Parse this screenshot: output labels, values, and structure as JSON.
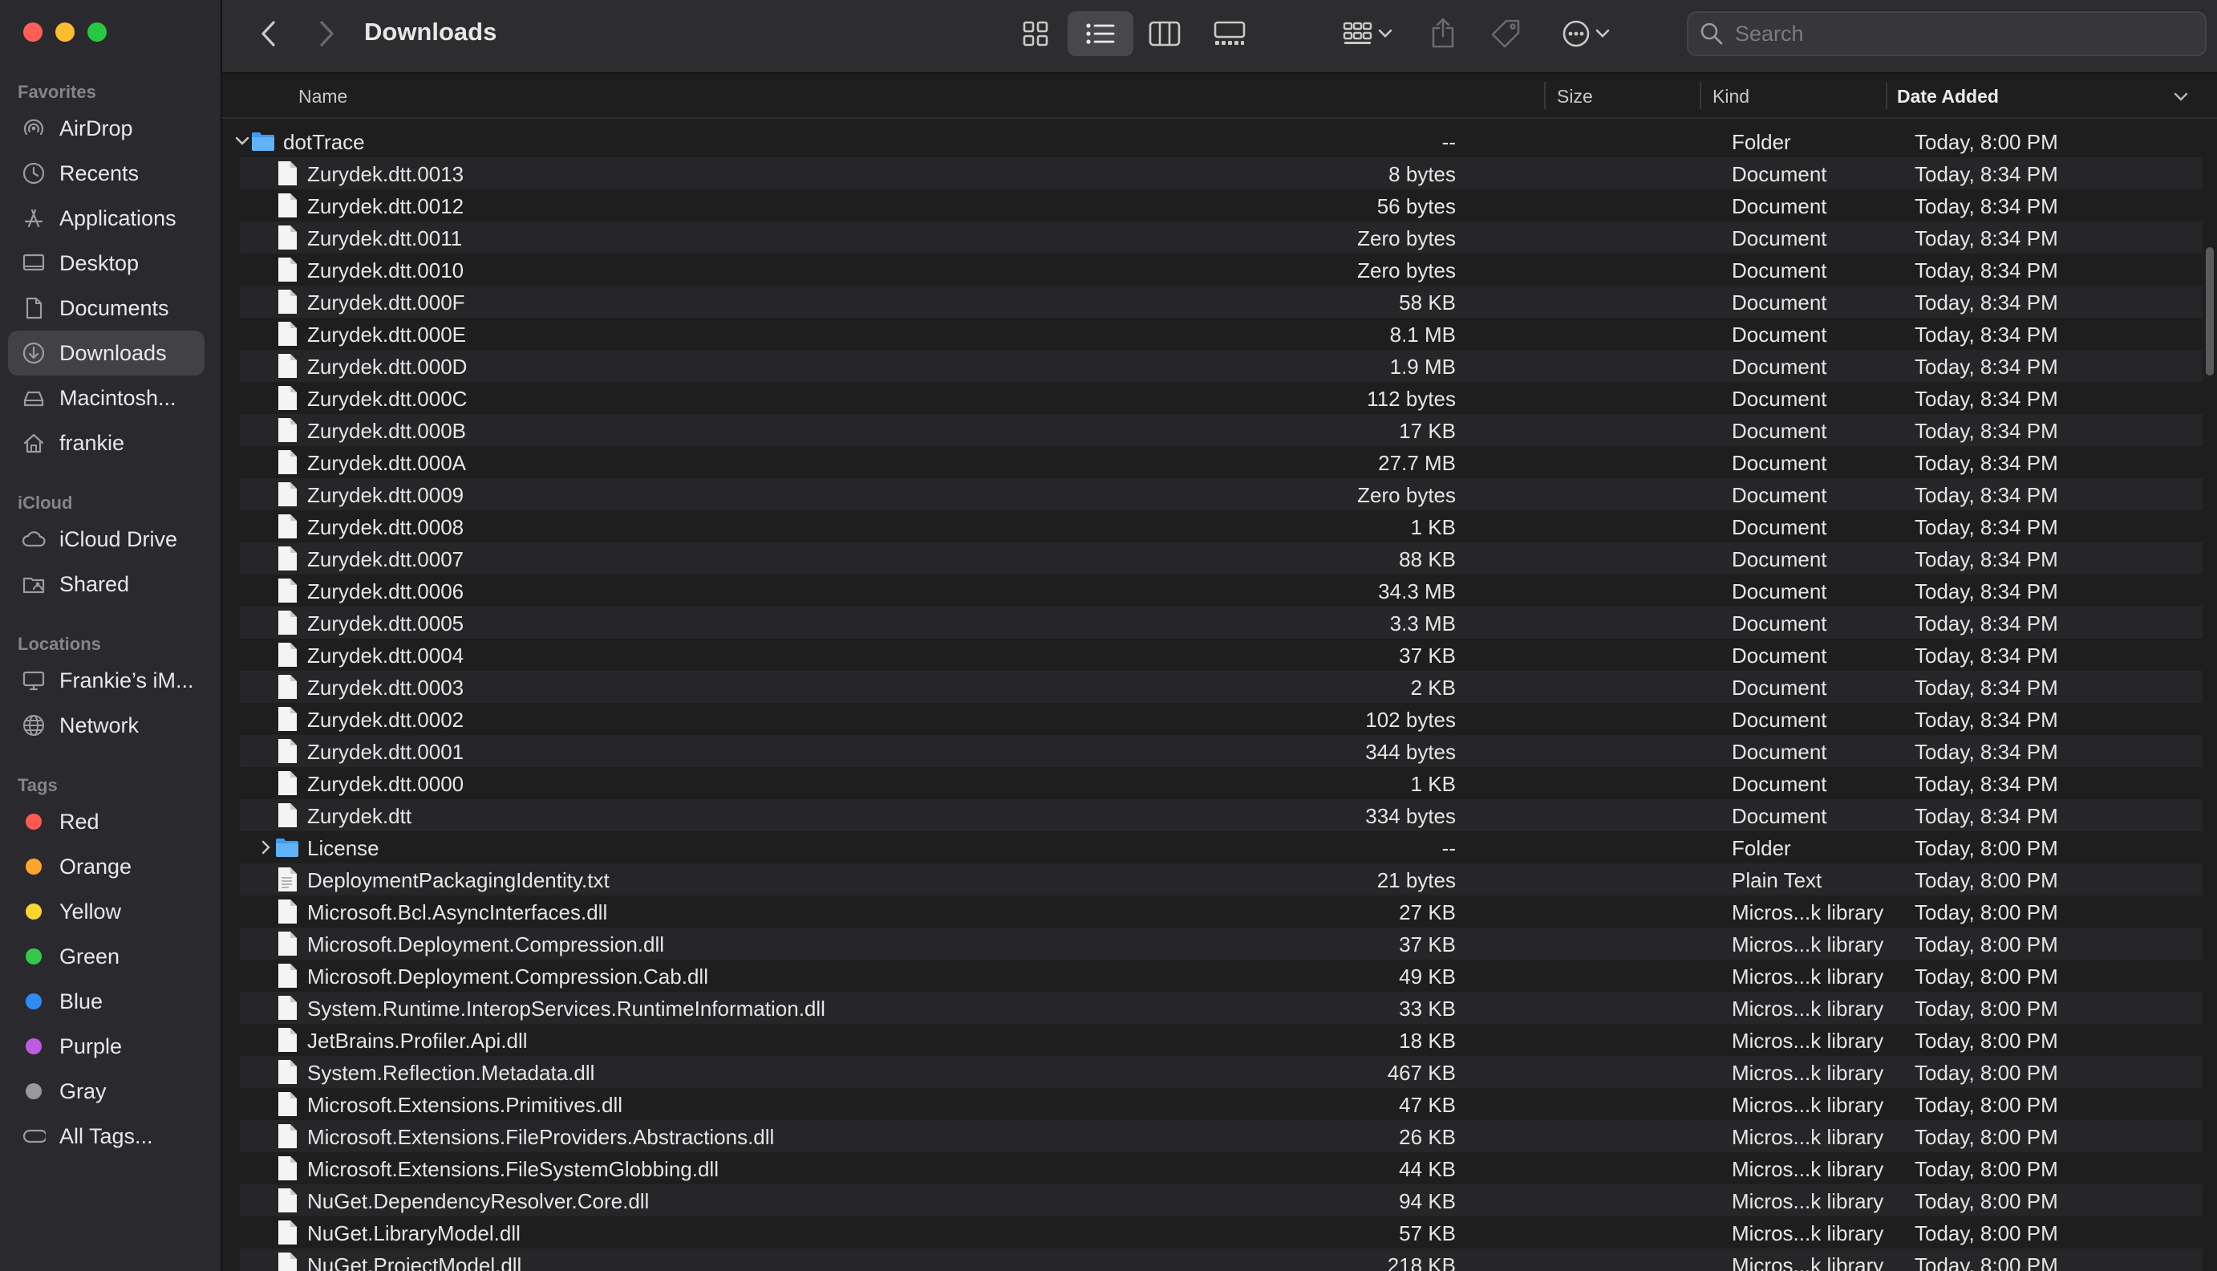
{
  "window": {
    "title": "Downloads"
  },
  "sidebar": {
    "sections": {
      "favorites": "Favorites",
      "icloud": "iCloud",
      "locations": "Locations",
      "tags": "Tags"
    },
    "favorites": [
      {
        "label": "AirDrop",
        "icon": "airdrop-icon"
      },
      {
        "label": "Recents",
        "icon": "clock-icon"
      },
      {
        "label": "Applications",
        "icon": "applications-icon"
      },
      {
        "label": "Desktop",
        "icon": "desktop-icon"
      },
      {
        "label": "Documents",
        "icon": "document-icon"
      },
      {
        "label": "Downloads",
        "icon": "download-icon",
        "active": true
      },
      {
        "label": "Macintosh...",
        "icon": "drive-icon"
      },
      {
        "label": "frankie",
        "icon": "home-icon"
      }
    ],
    "icloud": [
      {
        "label": "iCloud Drive",
        "icon": "cloud-icon"
      },
      {
        "label": "Shared",
        "icon": "shared-folder-icon"
      }
    ],
    "locations": [
      {
        "label": "Frankie’s iM...",
        "icon": "computer-icon"
      },
      {
        "label": "Network",
        "icon": "globe-icon"
      }
    ],
    "tags": [
      {
        "label": "Red",
        "color": "#ff5a52"
      },
      {
        "label": "Orange",
        "color": "#fea52b"
      },
      {
        "label": "Yellow",
        "color": "#fdd52f"
      },
      {
        "label": "Green",
        "color": "#36c84a"
      },
      {
        "label": "Blue",
        "color": "#2f8cf6"
      },
      {
        "label": "Purple",
        "color": "#bd5ce0"
      },
      {
        "label": "Gray",
        "color": "#98989d"
      },
      {
        "label": "All Tags...",
        "icon": "all-tags-icon"
      }
    ]
  },
  "search": {
    "placeholder": "Search"
  },
  "columns": {
    "name": "Name",
    "size": "Size",
    "kind": "Kind",
    "date": "Date Added"
  },
  "files": [
    {
      "name": "dotTrace",
      "size": "--",
      "kind": "Folder",
      "date": "Today, 8:00 PM",
      "type": "folder",
      "level": 0,
      "expanded": true
    },
    {
      "name": "Zurydek.dtt.0013",
      "size": "8 bytes",
      "kind": "Document",
      "date": "Today, 8:34 PM",
      "type": "doc",
      "level": 1
    },
    {
      "name": "Zurydek.dtt.0012",
      "size": "56 bytes",
      "kind": "Document",
      "date": "Today, 8:34 PM",
      "type": "doc",
      "level": 1
    },
    {
      "name": "Zurydek.dtt.0011",
      "size": "Zero bytes",
      "kind": "Document",
      "date": "Today, 8:34 PM",
      "type": "doc",
      "level": 1
    },
    {
      "name": "Zurydek.dtt.0010",
      "size": "Zero bytes",
      "kind": "Document",
      "date": "Today, 8:34 PM",
      "type": "doc",
      "level": 1
    },
    {
      "name": "Zurydek.dtt.000F",
      "size": "58 KB",
      "kind": "Document",
      "date": "Today, 8:34 PM",
      "type": "doc",
      "level": 1
    },
    {
      "name": "Zurydek.dtt.000E",
      "size": "8.1 MB",
      "kind": "Document",
      "date": "Today, 8:34 PM",
      "type": "doc",
      "level": 1
    },
    {
      "name": "Zurydek.dtt.000D",
      "size": "1.9 MB",
      "kind": "Document",
      "date": "Today, 8:34 PM",
      "type": "doc",
      "level": 1
    },
    {
      "name": "Zurydek.dtt.000C",
      "size": "112 bytes",
      "kind": "Document",
      "date": "Today, 8:34 PM",
      "type": "doc",
      "level": 1
    },
    {
      "name": "Zurydek.dtt.000B",
      "size": "17 KB",
      "kind": "Document",
      "date": "Today, 8:34 PM",
      "type": "doc",
      "level": 1
    },
    {
      "name": "Zurydek.dtt.000A",
      "size": "27.7 MB",
      "kind": "Document",
      "date": "Today, 8:34 PM",
      "type": "doc",
      "level": 1
    },
    {
      "name": "Zurydek.dtt.0009",
      "size": "Zero bytes",
      "kind": "Document",
      "date": "Today, 8:34 PM",
      "type": "doc",
      "level": 1
    },
    {
      "name": "Zurydek.dtt.0008",
      "size": "1 KB",
      "kind": "Document",
      "date": "Today, 8:34 PM",
      "type": "doc",
      "level": 1
    },
    {
      "name": "Zurydek.dtt.0007",
      "size": "88 KB",
      "kind": "Document",
      "date": "Today, 8:34 PM",
      "type": "doc",
      "level": 1
    },
    {
      "name": "Zurydek.dtt.0006",
      "size": "34.3 MB",
      "kind": "Document",
      "date": "Today, 8:34 PM",
      "type": "doc",
      "level": 1
    },
    {
      "name": "Zurydek.dtt.0005",
      "size": "3.3 MB",
      "kind": "Document",
      "date": "Today, 8:34 PM",
      "type": "doc",
      "level": 1
    },
    {
      "name": "Zurydek.dtt.0004",
      "size": "37 KB",
      "kind": "Document",
      "date": "Today, 8:34 PM",
      "type": "doc",
      "level": 1
    },
    {
      "name": "Zurydek.dtt.0003",
      "size": "2 KB",
      "kind": "Document",
      "date": "Today, 8:34 PM",
      "type": "doc",
      "level": 1
    },
    {
      "name": "Zurydek.dtt.0002",
      "size": "102 bytes",
      "kind": "Document",
      "date": "Today, 8:34 PM",
      "type": "doc",
      "level": 1
    },
    {
      "name": "Zurydek.dtt.0001",
      "size": "344 bytes",
      "kind": "Document",
      "date": "Today, 8:34 PM",
      "type": "doc",
      "level": 1
    },
    {
      "name": "Zurydek.dtt.0000",
      "size": "1 KB",
      "kind": "Document",
      "date": "Today, 8:34 PM",
      "type": "doc",
      "level": 1
    },
    {
      "name": "Zurydek.dtt",
      "size": "334 bytes",
      "kind": "Document",
      "date": "Today, 8:34 PM",
      "type": "doc",
      "level": 1
    },
    {
      "name": "License",
      "size": "--",
      "kind": "Folder",
      "date": "Today, 8:00 PM",
      "type": "folder",
      "level": 1,
      "expanded": false
    },
    {
      "name": "DeploymentPackagingIdentity.txt",
      "size": "21 bytes",
      "kind": "Plain Text",
      "date": "Today, 8:00 PM",
      "type": "text",
      "level": 1
    },
    {
      "name": "Microsoft.Bcl.AsyncInterfaces.dll",
      "size": "27 KB",
      "kind": "Micros...k library",
      "date": "Today, 8:00 PM",
      "type": "doc",
      "level": 1
    },
    {
      "name": "Microsoft.Deployment.Compression.dll",
      "size": "37 KB",
      "kind": "Micros...k library",
      "date": "Today, 8:00 PM",
      "type": "doc",
      "level": 1
    },
    {
      "name": "Microsoft.Deployment.Compression.Cab.dll",
      "size": "49 KB",
      "kind": "Micros...k library",
      "date": "Today, 8:00 PM",
      "type": "doc",
      "level": 1
    },
    {
      "name": "System.Runtime.InteropServices.RuntimeInformation.dll",
      "size": "33 KB",
      "kind": "Micros...k library",
      "date": "Today, 8:00 PM",
      "type": "doc",
      "level": 1
    },
    {
      "name": "JetBrains.Profiler.Api.dll",
      "size": "18 KB",
      "kind": "Micros...k library",
      "date": "Today, 8:00 PM",
      "type": "doc",
      "level": 1
    },
    {
      "name": "System.Reflection.Metadata.dll",
      "size": "467 KB",
      "kind": "Micros...k library",
      "date": "Today, 8:00 PM",
      "type": "doc",
      "level": 1
    },
    {
      "name": "Microsoft.Extensions.Primitives.dll",
      "size": "47 KB",
      "kind": "Micros...k library",
      "date": "Today, 8:00 PM",
      "type": "doc",
      "level": 1
    },
    {
      "name": "Microsoft.Extensions.FileProviders.Abstractions.dll",
      "size": "26 KB",
      "kind": "Micros...k library",
      "date": "Today, 8:00 PM",
      "type": "doc",
      "level": 1
    },
    {
      "name": "Microsoft.Extensions.FileSystemGlobbing.dll",
      "size": "44 KB",
      "kind": "Micros...k library",
      "date": "Today, 8:00 PM",
      "type": "doc",
      "level": 1
    },
    {
      "name": "NuGet.DependencyResolver.Core.dll",
      "size": "94 KB",
      "kind": "Micros...k library",
      "date": "Today, 8:00 PM",
      "type": "doc",
      "level": 1
    },
    {
      "name": "NuGet.LibraryModel.dll",
      "size": "57 KB",
      "kind": "Micros...k library",
      "date": "Today, 8:00 PM",
      "type": "doc",
      "level": 1
    },
    {
      "name": "NuGet.ProjectModel.dll",
      "size": "218 KB",
      "kind": "Micros...k library",
      "date": "Today, 8:00 PM",
      "type": "doc",
      "level": 1
    }
  ]
}
